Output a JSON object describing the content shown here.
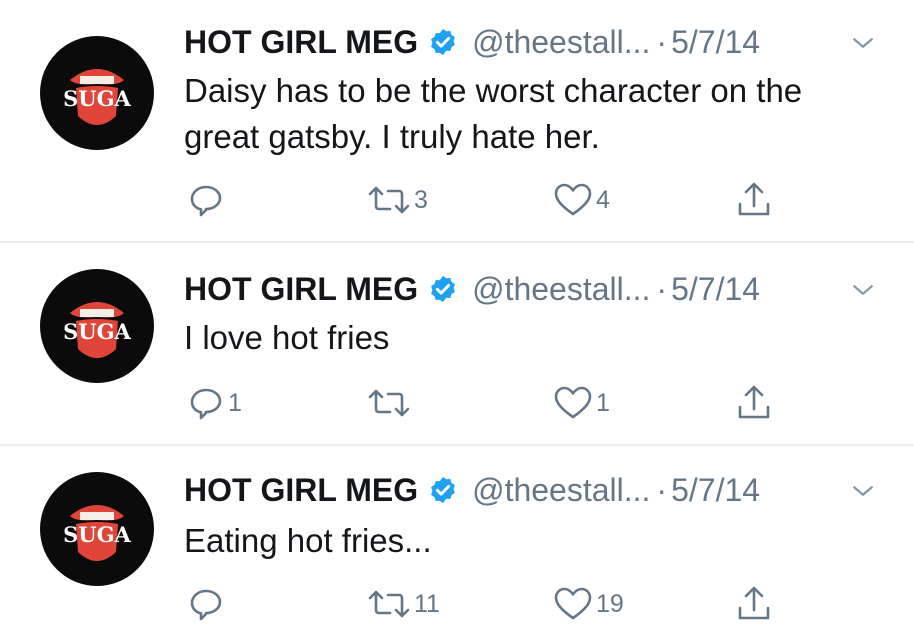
{
  "tweets": [
    {
      "name": "HOT GIRL MEG",
      "handle": "@theestall...",
      "separator": "·",
      "date": "5/7/14",
      "avatar_text": "SUGA",
      "text": "Daisy has to be the worst character on the great gatsby. I truly hate her.",
      "replies": "",
      "retweets": "3",
      "likes": "4"
    },
    {
      "name": "HOT GIRL MEG",
      "handle": "@theestall...",
      "separator": "·",
      "date": "5/7/14",
      "avatar_text": "SUGA",
      "text": "I love hot fries",
      "replies": "1",
      "retweets": "",
      "likes": "1"
    },
    {
      "name": "HOT GIRL MEG",
      "handle": "@theestall...",
      "separator": "·",
      "date": "5/7/14",
      "avatar_text": "SUGA",
      "text": "Eating hot fries...",
      "replies": "",
      "retweets": "11",
      "likes": "19"
    }
  ],
  "icons": {
    "verified": "verified-badge-icon",
    "more": "chevron-down-icon",
    "reply": "reply-icon",
    "retweet": "retweet-icon",
    "like": "heart-icon",
    "share": "share-icon"
  },
  "colors": {
    "text": "#14171a",
    "secondary": "#657786",
    "verified": "#1da1f2",
    "divider": "#e6ecf0",
    "avatar_bg": "#0b0b0b",
    "avatar_mouth": "#e0453a"
  }
}
